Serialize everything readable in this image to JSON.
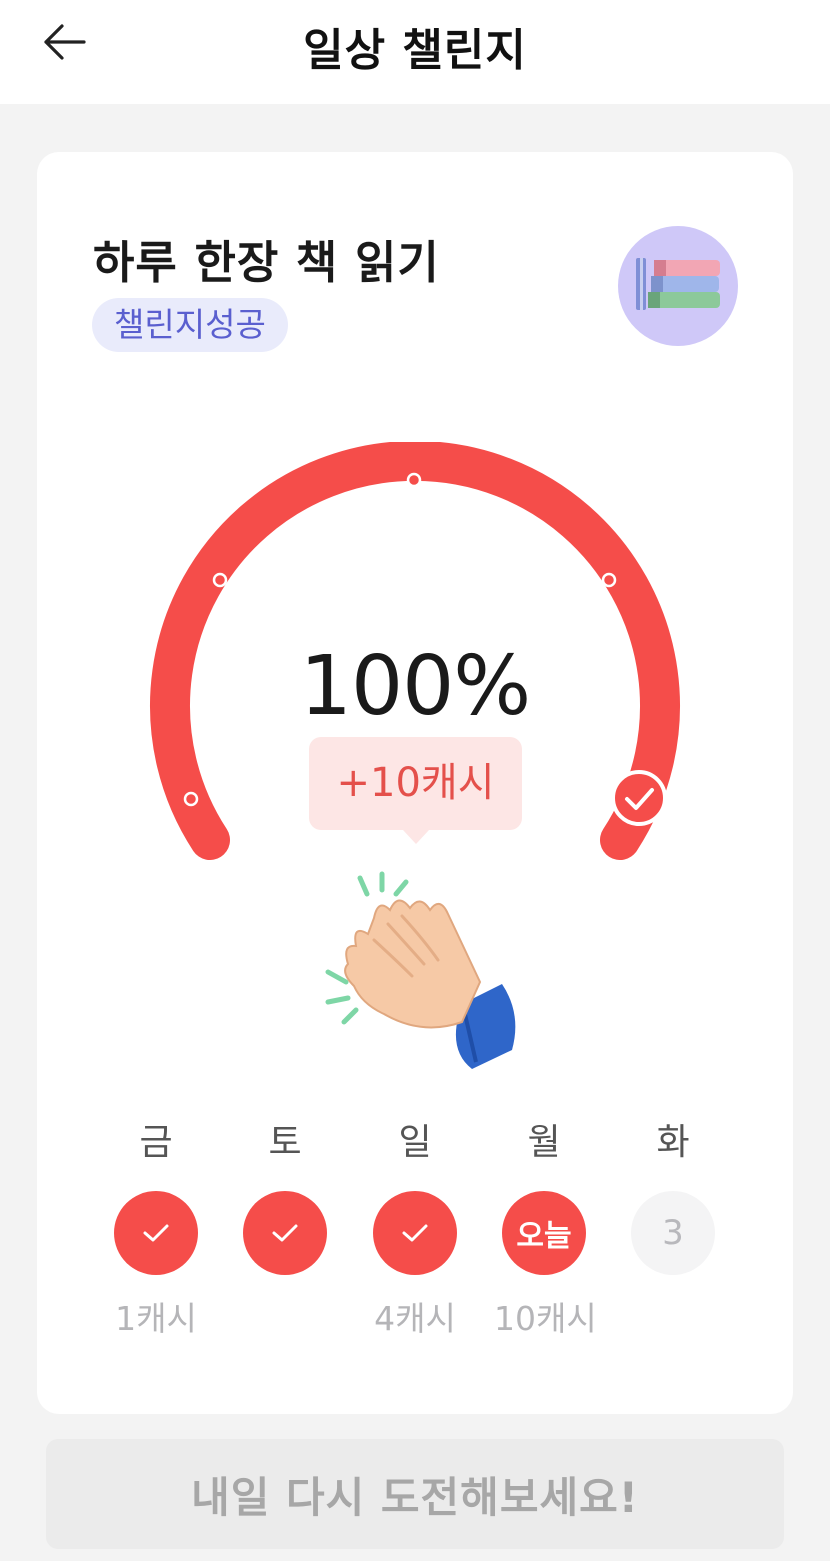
{
  "header": {
    "title": "일상 챌린지",
    "back_icon": "arrow-left-icon"
  },
  "challenge": {
    "title": "하루 한장 책 읽기",
    "status": "챌린지성공",
    "avatar_icon": "books-icon",
    "progress_text": "100%",
    "progress": 1.0,
    "reward_text": "+10캐시",
    "celebration_icon": "clapping-hands-icon"
  },
  "days": [
    {
      "label": "금",
      "state": "done",
      "circle_text": "",
      "reward": "1캐시"
    },
    {
      "label": "토",
      "state": "done",
      "circle_text": "",
      "reward": ""
    },
    {
      "label": "일",
      "state": "done",
      "circle_text": "",
      "reward": "4캐시"
    },
    {
      "label": "월",
      "state": "today",
      "circle_text": "오늘",
      "reward": "10캐시"
    },
    {
      "label": "화",
      "state": "future",
      "circle_text": "3",
      "reward": ""
    }
  ],
  "footer": {
    "button_label": "내일 다시 도전해보세요!"
  },
  "colors": {
    "accent": "#f54d4a",
    "badge_bg": "#e9ebfb",
    "badge_text": "#5a5fcf",
    "disabled_button": "#ebebeb"
  }
}
